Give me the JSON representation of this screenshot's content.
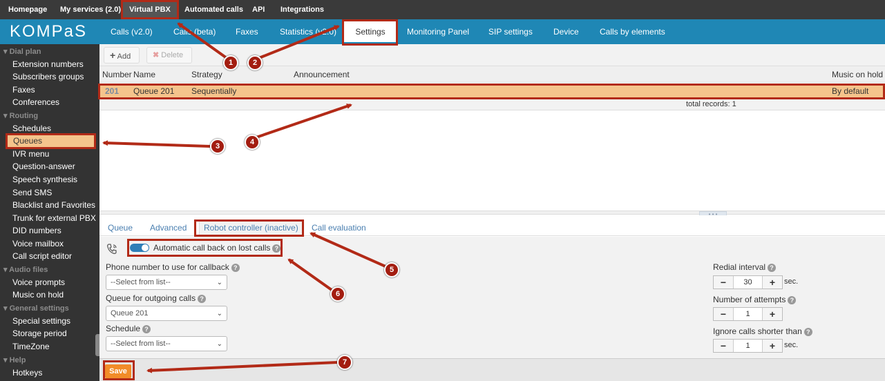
{
  "topbar": {
    "items": [
      "Homepage",
      "My services (2.0)",
      "Virtual PBX",
      "Automated calls",
      "API",
      "Integrations"
    ]
  },
  "brand": {
    "logo": "KOMPaS"
  },
  "nav": {
    "items": [
      "Calls (v2.0)",
      "Calls (beta)",
      "Faxes",
      "Statistics (v2.0)",
      "Settings",
      "Monitoring Panel",
      "SIP settings",
      "Device",
      "Calls by elements"
    ],
    "active": "Settings"
  },
  "sidebar": {
    "groups": {
      "dial_plan": "Dial plan",
      "routing": "Routing",
      "audio_files": "Audio files",
      "general_settings": "General settings",
      "help": "Help"
    },
    "items": {
      "extension_numbers": "Extension numbers",
      "subscribers_groups": "Subscribers groups",
      "faxes": "Faxes",
      "conferences": "Conferences",
      "schedules": "Schedules",
      "queues": "Queues",
      "ivr_menu": "IVR menu",
      "question_answer": "Question-answer",
      "speech_synthesis": "Speech synthesis",
      "send_sms": "Send SMS",
      "blacklist": "Blacklist and Favorites",
      "trunk": "Trunk for external PBX",
      "did_numbers": "DID numbers",
      "voice_mailbox": "Voice mailbox",
      "call_script_editor": "Call script editor",
      "voice_prompts": "Voice prompts",
      "music_on_hold": "Music on hold",
      "special_settings": "Special settings",
      "storage_period": "Storage period",
      "timezone": "TimeZone",
      "hotkeys": "Hotkeys"
    }
  },
  "toolbar": {
    "add": "Add",
    "delete": "Delete"
  },
  "table": {
    "headers": {
      "number": "Number",
      "name": "Name",
      "strategy": "Strategy",
      "announcement": "Announcement",
      "music": "Music on hold"
    },
    "row": {
      "number": "201",
      "name": "Queue 201",
      "strategy": "Sequentially",
      "announcement": "",
      "music": "By default"
    },
    "total": "total records: 1"
  },
  "tabs": [
    "Queue",
    "Advanced",
    "Robot controller (inactive)",
    "Call evaluation"
  ],
  "form": {
    "auto_callback": "Automatic call back on lost calls",
    "auto_callback_on": true,
    "phone_label": "Phone number to use for callback",
    "phone_value": "--Select from list--",
    "queue_label": "Queue for outgoing calls",
    "queue_value": "Queue 201",
    "schedule_label": "Schedule",
    "schedule_value": "--Select from list--",
    "redial_label": "Redial interval",
    "redial_value": "30",
    "redial_unit": "sec.",
    "attempts_label": "Number of attempts",
    "attempts_value": "1",
    "ignore_label": "Ignore calls shorter than",
    "ignore_value": "1",
    "ignore_unit": "sec.",
    "help": "?",
    "minus": "−",
    "plus": "+"
  },
  "save": "Save",
  "annotations": [
    "1",
    "2",
    "3",
    "4",
    "5",
    "6",
    "7"
  ],
  "colors": {
    "topbar": "#3a3a3a",
    "navbar": "#1f87b5",
    "sidebar": "#333333",
    "highlight_row": "#f5c48c",
    "save": "#f28c28",
    "annotation": "#a31d10"
  }
}
